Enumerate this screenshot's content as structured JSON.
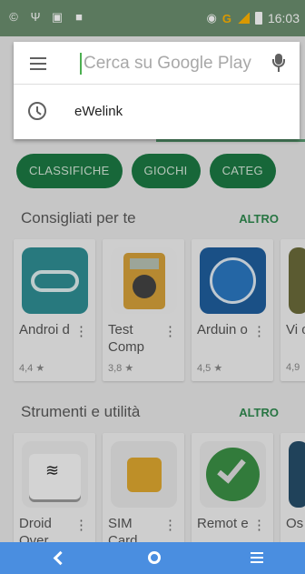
{
  "status_bar": {
    "time": "16:03",
    "network": "G"
  },
  "search": {
    "placeholder": "Cerca su Google Play",
    "value": ""
  },
  "suggestions": [
    {
      "label": "eWelink"
    }
  ],
  "chips": [
    "CLASSIFICHE",
    "GIOCHI",
    "CATEG"
  ],
  "sections": [
    {
      "title": "Consigliati per te",
      "more": "ALTRO",
      "apps": [
        {
          "name": "Androi d",
          "rating": "4,4 ★",
          "icon": "arduino-icon"
        },
        {
          "name": "Test Comp",
          "rating": "3,8 ★",
          "icon": "multimeter-icon"
        },
        {
          "name": "Arduin o",
          "rating": "4,5 ★",
          "icon": "plug-icon"
        },
        {
          "name": "Vi o",
          "rating": "4,9",
          "icon": "app-icon"
        }
      ]
    },
    {
      "title": "Strumenti e utilità",
      "more": "ALTRO",
      "apps": [
        {
          "name": "Droid Over",
          "icon": "wifi-drive-icon"
        },
        {
          "name": "SIM Card",
          "icon": "sim-card-icon"
        },
        {
          "name": "Remot e",
          "icon": "checkmark-icon"
        },
        {
          "name": "Os",
          "icon": "waveform-icon"
        }
      ]
    }
  ],
  "colors": {
    "accent": "#1c7a43",
    "navbar": "#4a8ee0",
    "more": "#2f8a4f"
  }
}
